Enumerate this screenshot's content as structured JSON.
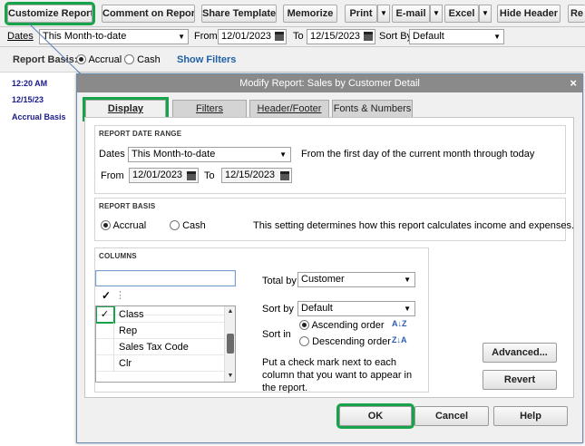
{
  "toolbar": {
    "customize_report": "Customize Report",
    "comment_on_report": "Comment on Report",
    "share_template": "Share Template",
    "memorize": "Memorize",
    "print": "Print",
    "email": "E-mail",
    "excel": "Excel",
    "hide_header": "Hide Header",
    "refresh_partial": "Re"
  },
  "filterbar": {
    "dates_label": "Dates",
    "dates_value": "This Month-to-date",
    "from_label": "From",
    "from_value": "12/01/2023",
    "to_label": "To",
    "to_value": "12/15/2023",
    "sortby_label": "Sort By",
    "sortby_value": "Default"
  },
  "basisrow": {
    "label": "Report Basis:",
    "accrual": "Accrual",
    "cash": "Cash",
    "show_filters": "Show Filters"
  },
  "report": {
    "time": "12:20 AM",
    "date": "12/15/23",
    "basis": "Accrual Basis"
  },
  "dialog": {
    "title": "Modify Report: Sales by Customer Detail",
    "close": "×",
    "tabs": [
      "Display",
      "Filters",
      "Header/Footer",
      "Fonts & Numbers"
    ],
    "date_range": {
      "title": "REPORT DATE RANGE",
      "dates_label": "Dates",
      "dates_value": "This Month-to-date",
      "description": "From the first day of the current month through today",
      "from_label": "From",
      "from_value": "12/01/2023",
      "to_label": "To",
      "to_value": "12/15/2023"
    },
    "report_basis": {
      "title": "REPORT BASIS",
      "accrual": "Accrual",
      "cash": "Cash",
      "description": "This setting determines how this report calculates income and expenses."
    },
    "columns": {
      "title": "COLUMNS",
      "search_value": "",
      "items": [
        {
          "checked": "",
          "label": "",
          "partial": true
        },
        {
          "checked": "✓",
          "label": "Class"
        },
        {
          "checked": "",
          "label": "Rep"
        },
        {
          "checked": "",
          "label": "Sales Tax Code"
        },
        {
          "checked": "",
          "label": "Clr"
        }
      ],
      "total_by_label": "Total by",
      "total_by_value": "Customer",
      "sort_by_label": "Sort by",
      "sort_by_value": "Default",
      "sort_in_label": "Sort in",
      "ascending": "Ascending order",
      "descending": "Descending order",
      "hint": "Put a check mark next to each column that you want to appear in the report."
    },
    "advanced": "Advanced...",
    "revert": "Revert",
    "ok": "OK",
    "cancel": "Cancel",
    "help": "Help"
  }
}
